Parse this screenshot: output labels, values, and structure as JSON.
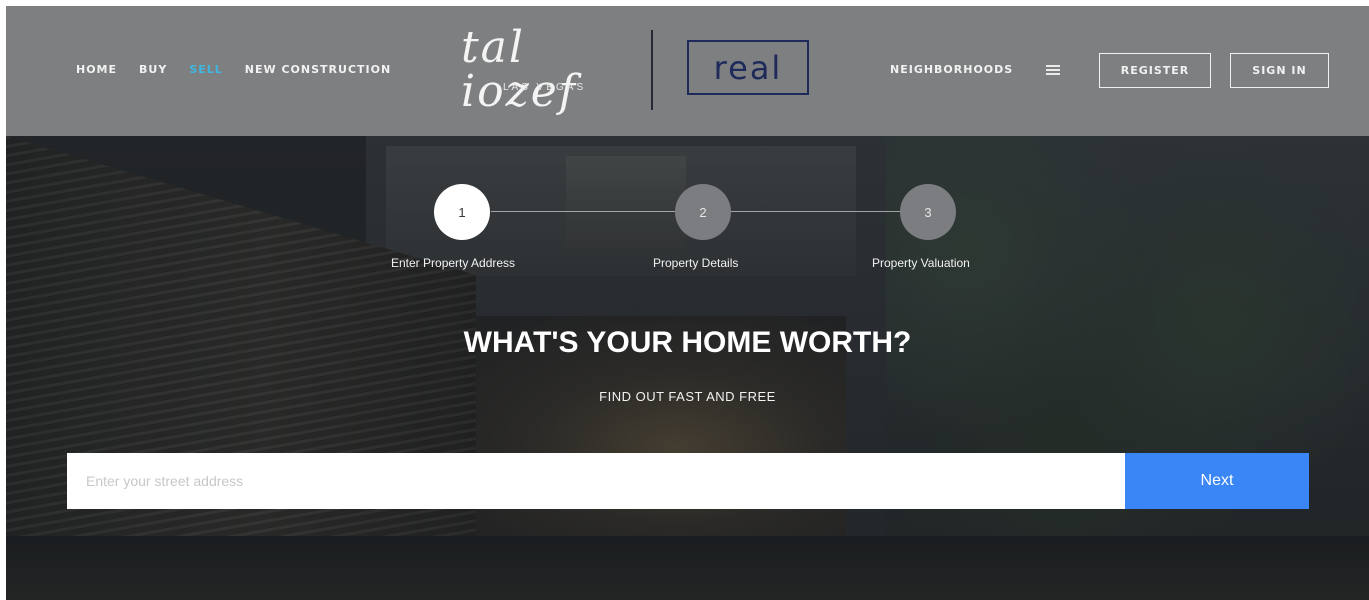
{
  "nav_left": {
    "items": [
      {
        "label": "HOME"
      },
      {
        "label": "BUY"
      },
      {
        "label": "SELL"
      },
      {
        "label": "NEW CONSTRUCTION"
      }
    ],
    "active_index": 2
  },
  "logo": {
    "script_text": "tal iozef",
    "subtitle": "LAS VEGAS",
    "partner_brand": "real"
  },
  "nav_right": {
    "neighborhoods_label": "NEIGHBORHOODS",
    "register_label": "REGISTER",
    "signin_label": "SIGN IN"
  },
  "steps": [
    {
      "number": "1",
      "label": "Enter Property Address",
      "active": true
    },
    {
      "number": "2",
      "label": "Property Details",
      "active": false
    },
    {
      "number": "3",
      "label": "Property Valuation",
      "active": false
    }
  ],
  "hero": {
    "title": "WHAT'S YOUR HOME WORTH?",
    "subtitle": "FIND OUT FAST AND FREE"
  },
  "search": {
    "placeholder": "Enter your street address",
    "value": "",
    "button_label": "Next"
  },
  "colors": {
    "header_bg": "#7d7f81",
    "active_nav": "#3fb6e0",
    "next_button": "#3a86f6",
    "brand_navy": "#1d2a5a"
  }
}
